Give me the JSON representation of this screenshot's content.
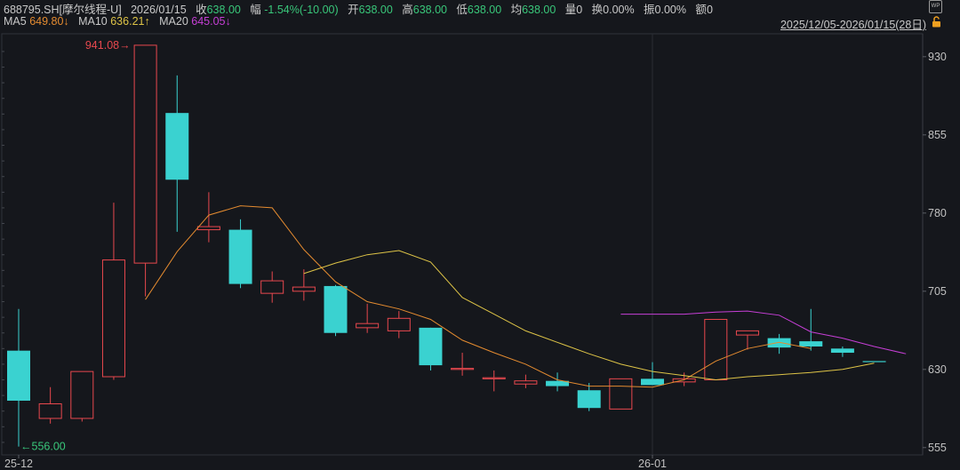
{
  "header": {
    "code": "688795.SH[摩尔线程-U]",
    "date": "2026/01/15",
    "close_label": "收",
    "close_value": "638.00",
    "chg_label": "幅",
    "chg_value": "-1.54%(-10.00)",
    "open_label": "开",
    "open_value": "638.00",
    "high_label": "高",
    "high_value": "638.00",
    "low_label": "低",
    "low_value": "638.00",
    "avg_label": "均",
    "avg_value": "638.00",
    "vol_label": "量",
    "vol_value": "0",
    "turnover_label": "换",
    "turnover_value": "0.00%",
    "amp_label": "振",
    "amp_value": "0.00%",
    "amount_label": "额",
    "amount_value": "0"
  },
  "ma_legend": {
    "ma5_label": "MA5",
    "ma5_value": "649.80↓",
    "ma10_label": "MA10",
    "ma10_value": "636.21↑",
    "ma20_label": "MA20",
    "ma20_value": "645.05↓"
  },
  "range_label": "2025/12/05-2026/01/15(28日)",
  "icons": {
    "corner": "wp-icon",
    "lock": "lock-icon"
  },
  "colors": {
    "up": "#e8484e",
    "down": "#3ad2d0",
    "ma5": "#e48b30",
    "ma10": "#dec447",
    "ma20": "#c63fd6",
    "bg": "#15171c"
  },
  "chart_data": {
    "type": "candlestick",
    "ylim": [
      548,
      952
    ],
    "yticks": [
      555,
      630,
      705,
      780,
      855,
      930
    ],
    "x_labels": [
      {
        "index": 0,
        "text": "25-12"
      },
      {
        "index": 20,
        "text": "26-01"
      }
    ],
    "high_annotation": {
      "index": 4,
      "text": "941.08"
    },
    "low_annotation": {
      "index": 0,
      "text": "556.00"
    },
    "candles": [
      {
        "o": 648,
        "c": 600,
        "h": 688,
        "l": 556
      },
      {
        "o": 583,
        "c": 597,
        "h": 613,
        "l": 578
      },
      {
        "o": 583,
        "c": 628,
        "h": 628,
        "l": 580
      },
      {
        "o": 623,
        "c": 735,
        "h": 790,
        "l": 620
      },
      {
        "o": 732,
        "c": 941,
        "h": 941,
        "l": 700
      },
      {
        "o": 876,
        "c": 812,
        "h": 912,
        "l": 762
      },
      {
        "o": 764,
        "c": 767,
        "h": 800,
        "l": 752
      },
      {
        "o": 764,
        "c": 712,
        "h": 774,
        "l": 708
      },
      {
        "o": 703,
        "c": 715,
        "h": 724,
        "l": 694
      },
      {
        "o": 705,
        "c": 709,
        "h": 726,
        "l": 696
      },
      {
        "o": 710,
        "c": 665,
        "h": 711,
        "l": 662
      },
      {
        "o": 670,
        "c": 674,
        "h": 693,
        "l": 665
      },
      {
        "o": 667,
        "c": 679,
        "h": 686,
        "l": 660
      },
      {
        "o": 670,
        "c": 634,
        "h": 670,
        "l": 629
      },
      {
        "o": 630,
        "c": 631,
        "h": 646,
        "l": 624
      },
      {
        "o": 621,
        "c": 622,
        "h": 629,
        "l": 609
      },
      {
        "o": 616,
        "c": 619,
        "h": 625,
        "l": 612
      },
      {
        "o": 619,
        "c": 614,
        "h": 627,
        "l": 609
      },
      {
        "o": 610,
        "c": 593,
        "h": 617,
        "l": 590
      },
      {
        "o": 592,
        "c": 621,
        "h": 621,
        "l": 592
      },
      {
        "o": 621,
        "c": 615,
        "h": 637,
        "l": 615
      },
      {
        "o": 618,
        "c": 621,
        "h": 627,
        "l": 614
      },
      {
        "o": 620,
        "c": 678,
        "h": 678,
        "l": 620
      },
      {
        "o": 663,
        "c": 667,
        "h": 667,
        "l": 649
      },
      {
        "o": 660,
        "c": 651,
        "h": 664,
        "l": 645
      },
      {
        "o": 657,
        "c": 652,
        "h": 688,
        "l": 648
      },
      {
        "o": 650,
        "c": 646,
        "h": 652,
        "l": 642
      },
      {
        "o": 638,
        "c": 638,
        "h": 638,
        "l": 638
      }
    ],
    "series": [
      {
        "name": "MA5",
        "start": 4,
        "values": [
          697,
          743,
          778,
          787,
          785,
          745,
          714,
          695,
          688,
          678,
          658,
          646,
          635,
          620,
          614,
          614,
          613,
          620,
          638,
          650,
          656,
          650
        ]
      },
      {
        "name": "MA10",
        "start": 9,
        "values": [
          722,
          732,
          740,
          744,
          733,
          699,
          683,
          667,
          656,
          645,
          635,
          628,
          624,
          620,
          623,
          625,
          627,
          630,
          636
        ]
      },
      {
        "name": "MA20",
        "start": 19,
        "values": [
          683,
          683,
          683,
          685,
          686,
          682,
          666,
          660,
          652,
          645
        ]
      }
    ]
  }
}
